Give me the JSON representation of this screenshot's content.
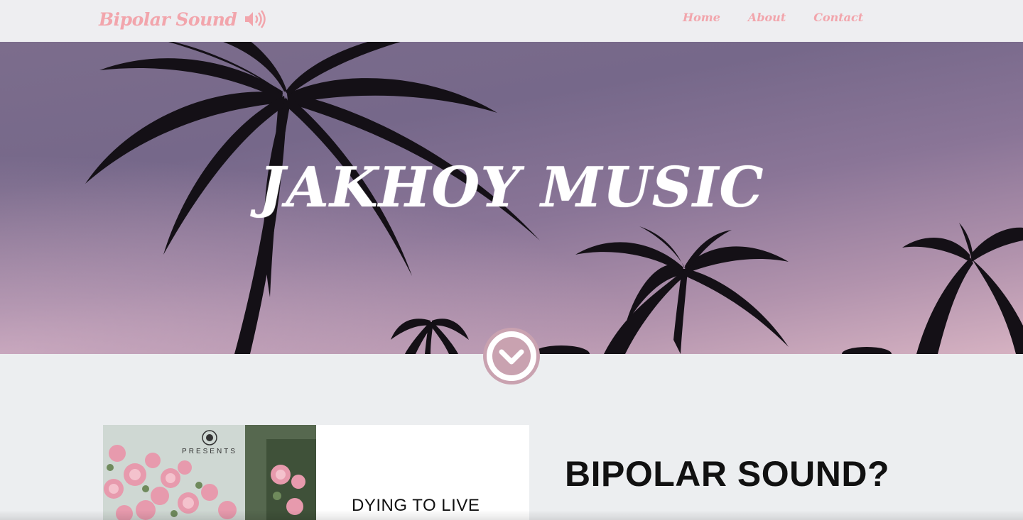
{
  "nav": {
    "brand": "Bipolar Sound",
    "brand_icon": "speaker-volume-icon",
    "links": [
      "Home",
      "About",
      "Contact"
    ]
  },
  "hero": {
    "title": "JAKHOY MUSIC",
    "scroll_icon": "chevron-down-icon"
  },
  "album": {
    "label_text": "PRESENTS",
    "title": "DYING TO LIVE"
  },
  "about": {
    "heading": "BIPOLAR SOUND?"
  },
  "colors": {
    "accent": "#f2a5ac",
    "hero_tint": "#7c6d8c",
    "button_ring": "#c9a2b0",
    "page_bg": "#eceef0"
  }
}
